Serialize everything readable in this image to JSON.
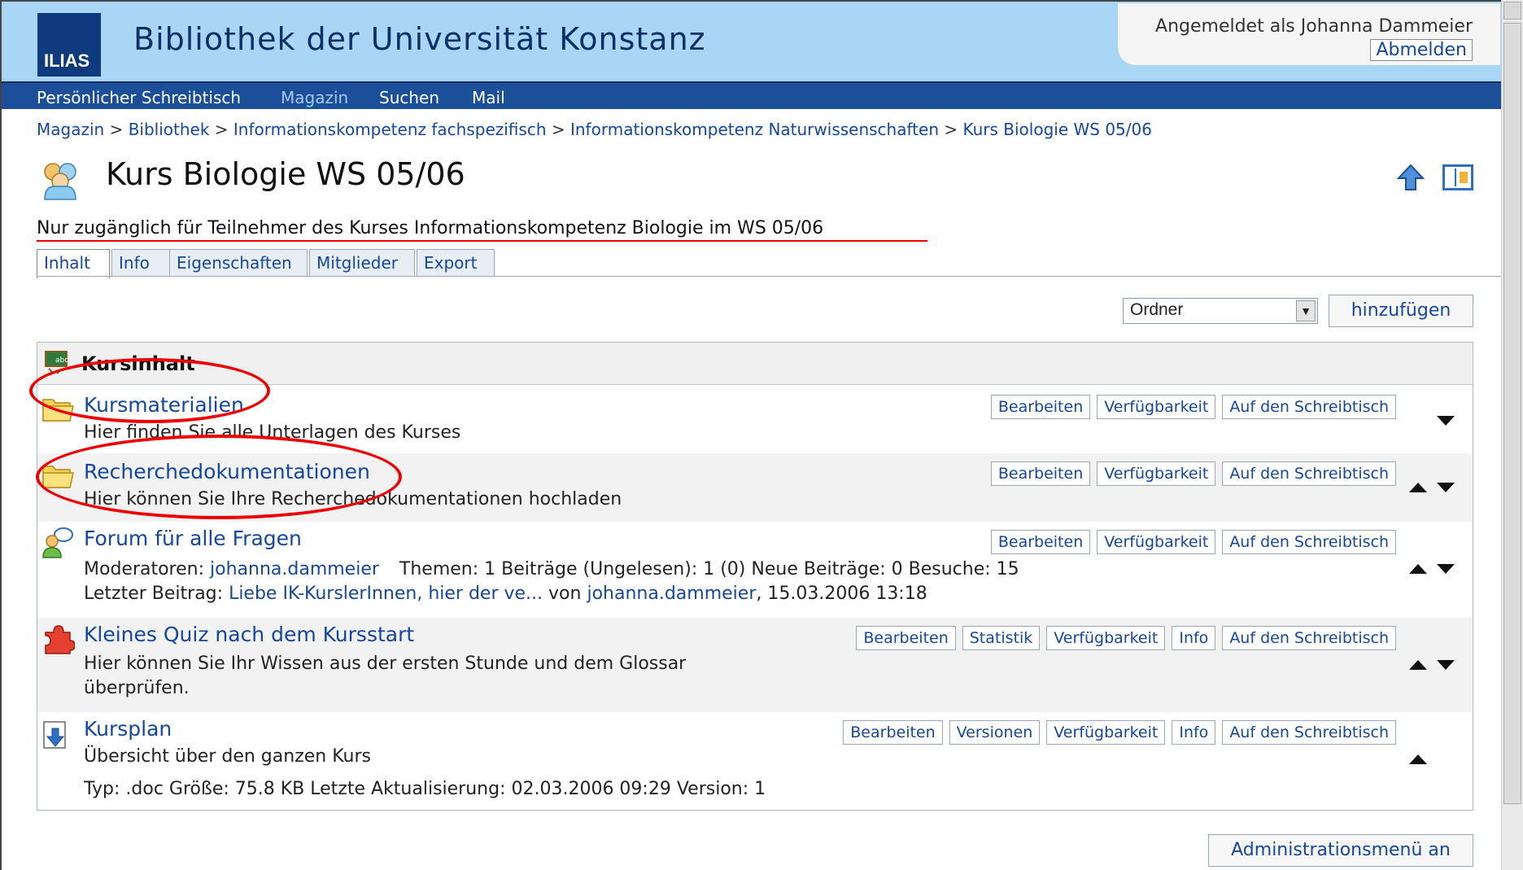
{
  "header": {
    "logo_text": "ILIAS",
    "site_title": "Bibliothek der Universität Konstanz",
    "logged_in_as": "Angemeldet als Johanna Dammeier",
    "logout": "Abmelden"
  },
  "nav": {
    "items": [
      "Persönlicher Schreibtisch",
      "Magazin",
      "Suchen",
      "Mail"
    ],
    "active": "Magazin"
  },
  "breadcrumb": {
    "items": [
      "Magazin",
      "Bibliothek",
      "Informationskompetenz fachspezifisch",
      "Informationskompetenz Naturwissenschaften",
      "Kurs Biologie WS 05/06"
    ],
    "separator": ">"
  },
  "page": {
    "title": "Kurs Biologie WS 05/06",
    "description": "Nur zugänglich für Teilnehmer des Kurses Informationskompetenz Biologie im WS 05/06"
  },
  "tabs": [
    "Inhalt",
    "Info",
    "Eigenschaften",
    "Mitglieder",
    "Export"
  ],
  "add": {
    "select_value": "Ordner",
    "button": "hinzufügen"
  },
  "box": {
    "title": "Kursinhalt",
    "items": [
      {
        "name": "Kursmaterialien",
        "description": "Hier finden Sie alle Unterlagen des Kurses",
        "buttons": [
          "Bearbeiten",
          "Verfügbarkeit",
          "Auf den Schreibtisch"
        ]
      },
      {
        "name": "Recherchedokumentationen",
        "description": "Hier können Sie Ihre Recherchedokumentationen hochladen",
        "buttons": [
          "Bearbeiten",
          "Verfügbarkeit",
          "Auf den Schreibtisch"
        ]
      },
      {
        "name": "Forum für alle Fragen",
        "moderators_label": "Moderatoren:",
        "moderator": "johanna.dammeier",
        "stats": "Themen: 1   Beiträge (Ungelesen): 1 (0)   Neue Beiträge: 0   Besuche: 15",
        "last_post_label": "Letzter Beitrag:",
        "last_post_link": "Liebe IK-KurslerInnen, hier der ve...",
        "by": "von",
        "last_post_author": "johanna.dammeier",
        "last_post_date": ", 15.03.2006 13:18",
        "buttons": [
          "Bearbeiten",
          "Verfügbarkeit",
          "Auf den Schreibtisch"
        ]
      },
      {
        "name": "Kleines Quiz nach dem Kursstart",
        "description_line1": "Hier können Sie Ihr Wissen aus der ersten Stunde und dem Glossar",
        "description_line2": "überprüfen.",
        "buttons": [
          "Bearbeiten",
          "Statistik",
          "Verfügbarkeit",
          "Info",
          "Auf den Schreibtisch"
        ]
      },
      {
        "name": "Kursplan",
        "description": "Übersicht über den ganzen Kurs",
        "meta": "Typ: .doc   Größe: 75.8 KB   Letzte Aktualisierung: 02.03.2006 09:29   Version: 1",
        "buttons": [
          "Bearbeiten",
          "Versionen",
          "Verfügbarkeit",
          "Info",
          "Auf den Schreibtisch"
        ]
      }
    ]
  },
  "footer": {
    "admin_button": "Administrationsmenü an"
  },
  "colors": {
    "header_bg": "#a9d6f4",
    "nav_bg": "#1c4f9a",
    "link": "#1547a0",
    "annotation": "#e00000"
  }
}
